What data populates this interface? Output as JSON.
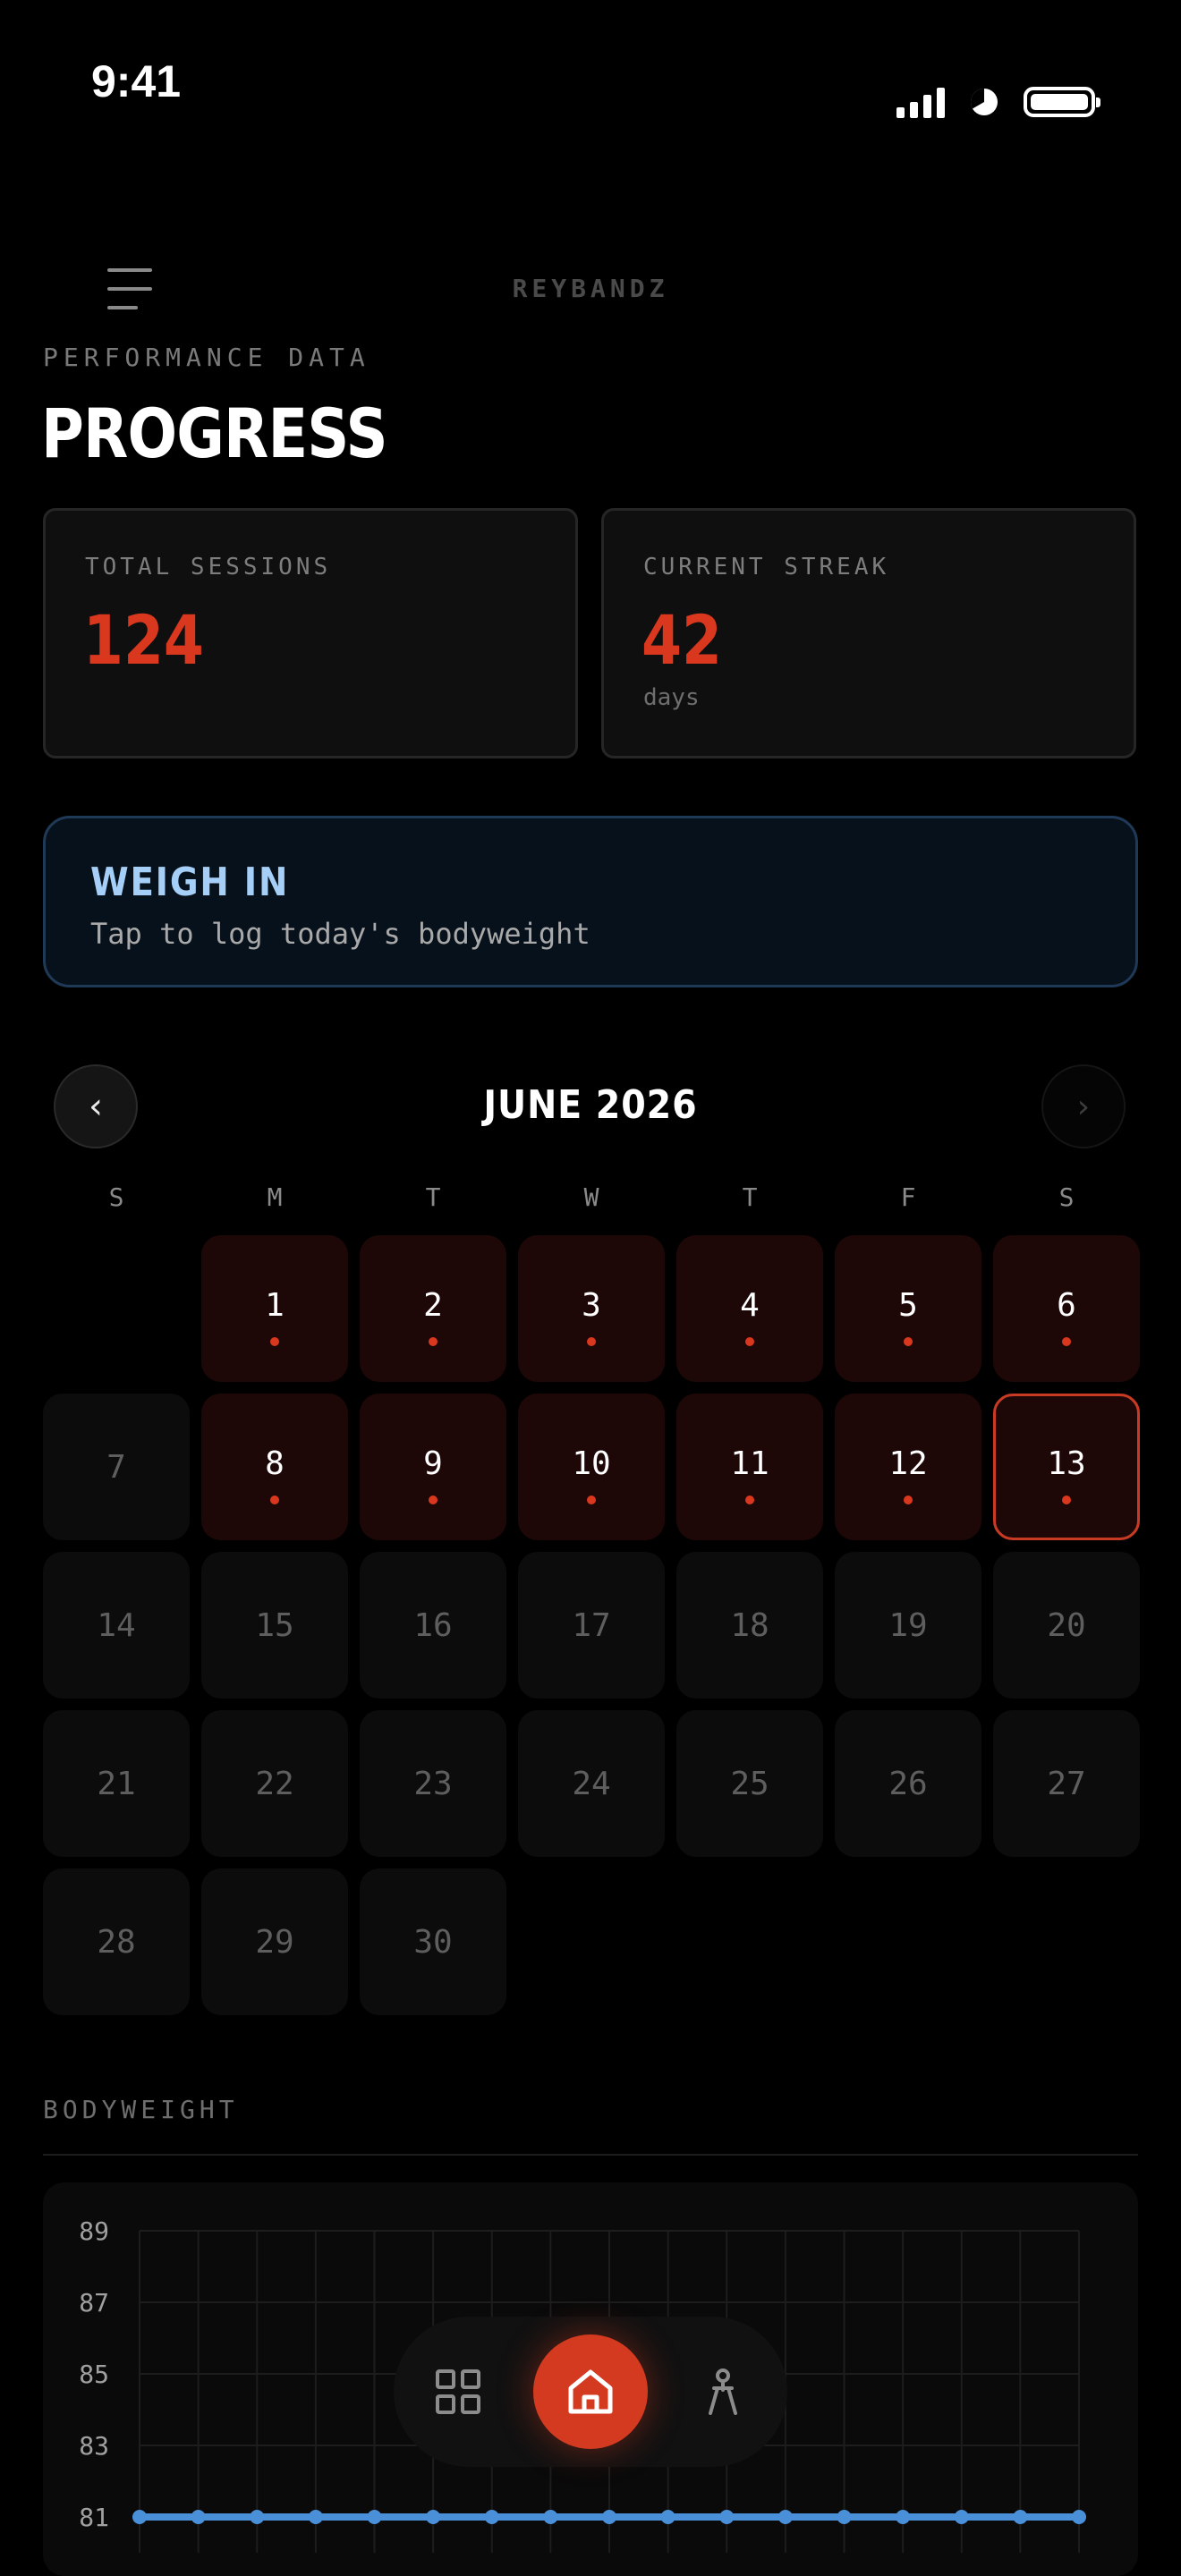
{
  "status_bar": {
    "time": "9:41"
  },
  "header": {
    "brand": "REYBANDZ",
    "menu_icon": "hamburger-menu-icon"
  },
  "page": {
    "eyebrow": "PERFORMANCE DATA",
    "title": "PROGRESS"
  },
  "stats": [
    {
      "label": "TOTAL SESSIONS",
      "value": "124",
      "unit": ""
    },
    {
      "label": "CURRENT STREAK",
      "value": "42",
      "unit": "days"
    }
  ],
  "weigh_in": {
    "title": "WEIGH IN",
    "subtitle": "Tap to log today's bodyweight"
  },
  "calendar": {
    "month_label": "JUNE 2026",
    "prev_label": "‹",
    "next_label": "›",
    "weekdays": [
      "S",
      "M",
      "T",
      "W",
      "T",
      "F",
      "S"
    ],
    "start_offset": 1,
    "days_in_month": 30,
    "session_days": [
      1,
      2,
      3,
      4,
      5,
      6,
      8,
      9,
      10,
      11,
      12,
      13
    ],
    "today": 13,
    "colors": {
      "active_bg": "#1e0807",
      "dot": "#d9381e",
      "today_border": "#c93a25"
    }
  },
  "bodyweight": {
    "section_label": "BODYWEIGHT",
    "chart_data": {
      "type": "line",
      "title": "",
      "xlabel": "",
      "ylabel": "",
      "y_ticks": [
        "89",
        "87",
        "85",
        "83",
        "81"
      ],
      "ylim": [
        81,
        89
      ],
      "series": [
        {
          "values": [
            81,
            81,
            81,
            81,
            81,
            81,
            81,
            81,
            81,
            81,
            81,
            81,
            81,
            81,
            81,
            81,
            81
          ]
        }
      ],
      "color": "#4a90d9",
      "grid": true
    }
  },
  "bottom_nav": {
    "items": [
      {
        "name": "dashboard-grid-icon",
        "active": false
      },
      {
        "name": "home-icon",
        "active": true
      },
      {
        "name": "profile-figure-icon",
        "active": false
      }
    ],
    "accent": "#d33a20"
  }
}
